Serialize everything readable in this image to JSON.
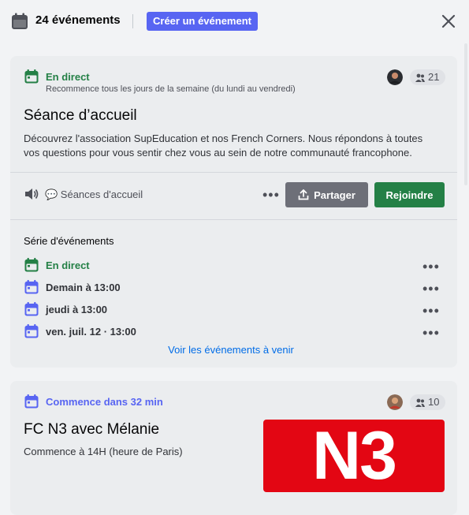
{
  "header": {
    "count_label": "24 événements",
    "create_label": "Créer un événement"
  },
  "colors": {
    "accent": "#5865f2",
    "live_green": "#248046",
    "link_blue": "#006ce7",
    "n3_red": "#e30613"
  },
  "icons": {
    "header": "calendar-icon",
    "close": "close-icon",
    "stage": "speaker-icon",
    "channel": "speech-bubble-icon",
    "share": "share-icon",
    "people": "people-icon"
  },
  "event1": {
    "status": "En direct",
    "recurrence": "Recommence tous les jours de la semaine (du lundi au vendredi)",
    "attendees": "21",
    "title": "Séance d’accueil",
    "description_line1": "Découvrez l'association SupEducation et nos French Corners. Nous répondons à toutes",
    "description_line2": "vos questions pour vous sentir chez vous au sein de notre communauté francophone.",
    "channel": "💬 Séances d'accueil",
    "more_label": "•••",
    "share_label": "Partager",
    "join_label": "Rejoindre",
    "series_title": "Série d'événements",
    "series": [
      {
        "label": "En direct",
        "more": "•••"
      },
      {
        "label": "Demain à 13:00",
        "more": "•••"
      },
      {
        "label": "jeudi à 13:00",
        "more": "•••"
      },
      {
        "label": "ven. juil. 12 · 13:00",
        "more": "•••"
      }
    ],
    "upcoming_link": "Voir les événements à venir"
  },
  "event2": {
    "status": "Commence dans 32 min",
    "attendees": "10",
    "title": "FC N3 avec Mélanie",
    "description": "Commence à 14H (heure de Paris)",
    "image_text": "N3"
  }
}
